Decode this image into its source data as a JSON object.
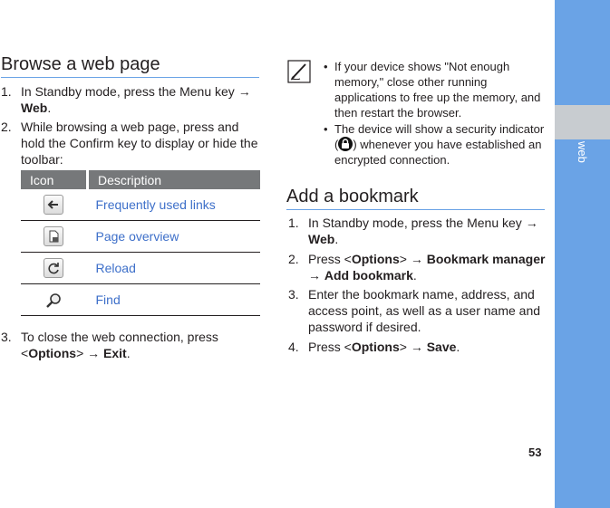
{
  "sidebar": {
    "label": "web"
  },
  "page_number": "53",
  "browse": {
    "title": "Browse a web page",
    "steps": [
      {
        "num": "1.",
        "text_a": "In Standby mode, press the Menu key → ",
        "bold_a": "Web",
        "text_b": "."
      },
      {
        "num": "2.",
        "text_a": "While browsing a web page, press and hold the Confirm key to display or hide the toolbar:"
      },
      {
        "num": "3.",
        "text_a": "To close the web connection, press <",
        "bold_a": "Options",
        "text_b": "> → ",
        "bold_b": "Exit",
        "text_c": "."
      }
    ],
    "table": {
      "headers": {
        "icon": "Icon",
        "description": "Description"
      },
      "rows": [
        {
          "icon": "back-arrow-icon",
          "description": "Frequently used links"
        },
        {
          "icon": "page-icon",
          "description": "Page overview"
        },
        {
          "icon": "reload-icon",
          "description": "Reload"
        },
        {
          "icon": "magnifier-icon",
          "description": "Find"
        }
      ]
    }
  },
  "note": {
    "icon": "pen-note-icon",
    "items": [
      {
        "text": "If your device shows \"Not enough memory,\" close other running applications to free up the memory, and then restart the browser."
      },
      {
        "text_a": "The device will show a security indicator (",
        "icon": "lock-icon",
        "text_b": ") whenever you have established an encrypted connection."
      }
    ]
  },
  "bookmark": {
    "title": "Add a bookmark",
    "steps": [
      {
        "num": "1.",
        "text_a": "In Standby mode, press the Menu key → ",
        "bold_a": "Web",
        "text_b": "."
      },
      {
        "num": "2.",
        "text_a": "Press <",
        "bold_a": "Options",
        "text_b": "> → ",
        "bold_b": "Bookmark manager",
        "text_c": " → ",
        "bold_c": "Add bookmark",
        "text_d": "."
      },
      {
        "num": "3.",
        "text_a": "Enter the bookmark name, address, and access point, as well as a user name and password if desired."
      },
      {
        "num": "4.",
        "text_a": "Press <",
        "bold_a": "Options",
        "text_b": "> → ",
        "bold_b": "Save",
        "text_c": "."
      }
    ]
  },
  "colors": {
    "accent": "#6aa3e6",
    "band": "#c8ccd0",
    "link": "#3d6fc9",
    "table_header": "#76787a"
  }
}
